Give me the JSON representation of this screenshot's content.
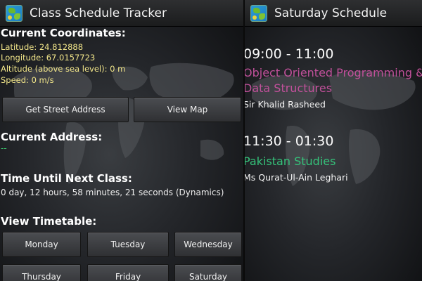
{
  "left": {
    "title": "Class Schedule Tracker",
    "coordinates": {
      "heading": "Current Coordinates:",
      "latitude": "Latitude: 24.812888",
      "longitude": "Longitude: 67.0157723",
      "altitude": "Altitude (above sea level): 0 m",
      "speed": "Speed: 0 m/s"
    },
    "buttons": {
      "street_address": "Get Street Address",
      "view_map": "View Map"
    },
    "address": {
      "heading": "Current Address:",
      "value": "--"
    },
    "next_class": {
      "heading": "Time Until Next Class:",
      "value": "0 day, 12 hours, 58 minutes, 21 seconds (Dynamics)"
    },
    "timetable": {
      "heading": "View Timetable:",
      "days": [
        "Monday",
        "Tuesday",
        "Wednesday",
        "Thursday",
        "Friday",
        "Saturday"
      ]
    }
  },
  "right": {
    "title": "Saturday Schedule",
    "entries": [
      {
        "time": "09:00 - 11:00",
        "course": "Object Oriented Programming & Data Structures",
        "course_color": "#c0509a",
        "teacher": "Sir Khalid Rasheed"
      },
      {
        "time": "11:30 - 01:30",
        "course": "Pakistan Studies",
        "course_color": "#35c27a",
        "teacher": "Ms Qurat-Ul-Ain Leghari"
      }
    ]
  },
  "colors": {
    "coordinate_text": "#f2e68a",
    "address_text": "#3cc66e"
  },
  "icons": [
    "app-globe-icon"
  ]
}
